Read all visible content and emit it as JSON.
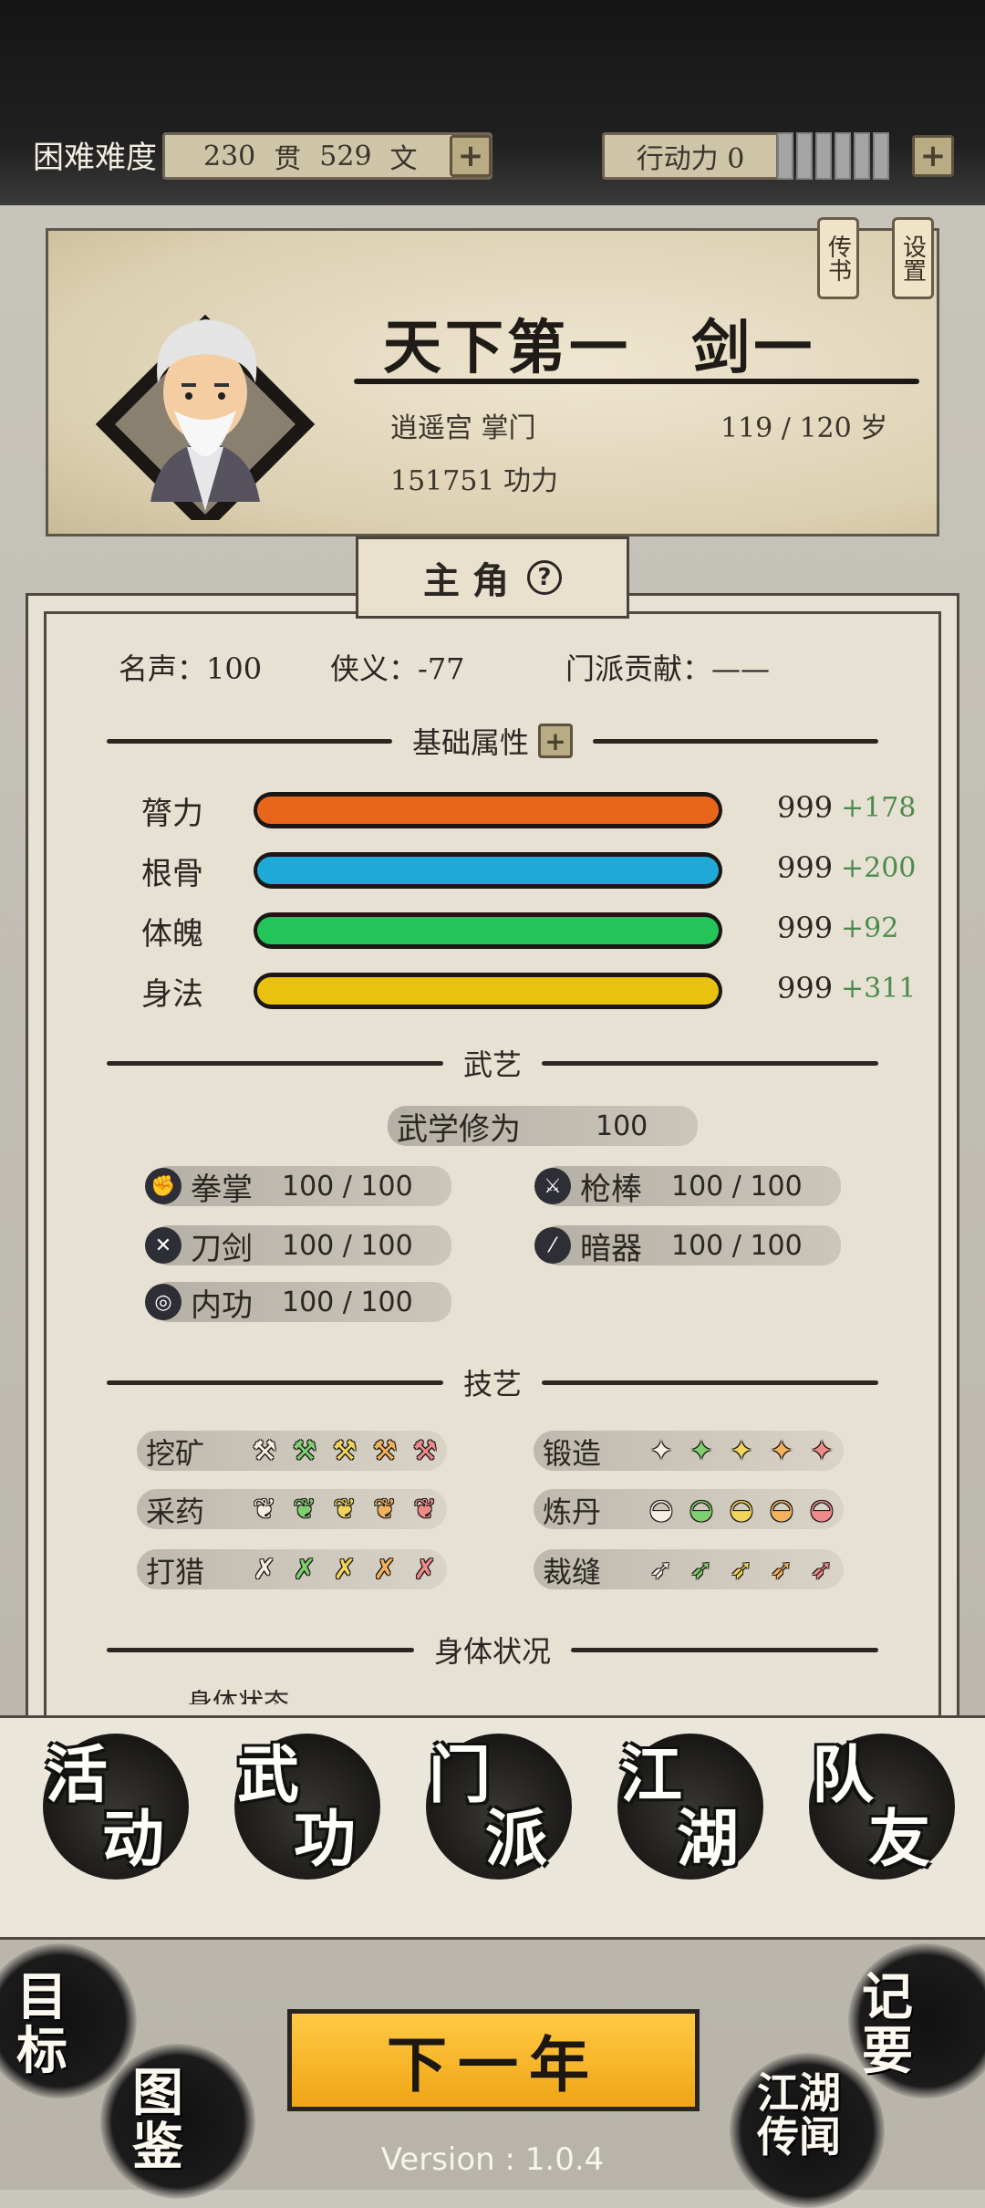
{
  "top_bar": {
    "difficulty": "困难难度",
    "money": {
      "guan_value": "230",
      "guan_unit": "贯",
      "wen_value": "529",
      "wen_unit": "文"
    },
    "action_points_label": "行动力 0",
    "action_points": {
      "value": 0,
      "max": 6
    }
  },
  "profile": {
    "title": "天下第一",
    "name": "剑一",
    "sect_role": "逍遥宫 掌门",
    "age": "119 / 120 岁",
    "power": "151751 功力",
    "tag_letters": "传书",
    "tag_settings": "设置"
  },
  "panel": {
    "tab_title": "主 角",
    "fame": "名声：100",
    "chivalry": "侠义：-77",
    "sect_contribution": "门派贡献：——"
  },
  "sections": {
    "basic": "基础属性",
    "martial": "武艺",
    "craft": "技艺",
    "body": "身体状况"
  },
  "attributes": [
    {
      "label": "膂力",
      "value": "999",
      "bonus": "+178",
      "fill": 1.0,
      "color": "#e8661a"
    },
    {
      "label": "根骨",
      "value": "999",
      "bonus": "+200",
      "fill": 1.0,
      "color": "#1fa9d6"
    },
    {
      "label": "体魄",
      "value": "999",
      "bonus": "+92",
      "fill": 1.0,
      "color": "#23c45a"
    },
    {
      "label": "身法",
      "value": "999",
      "bonus": "+311",
      "fill": 1.0,
      "color": "#e9c20f"
    }
  ],
  "martial": {
    "cultivation_label": "武学修为",
    "cultivation_value": "100",
    "skills": [
      {
        "label": "拳掌",
        "value": "100 / 100",
        "icon": "fist-icon"
      },
      {
        "label": "枪棒",
        "value": "100 / 100",
        "icon": "spear-icon"
      },
      {
        "label": "刀剑",
        "value": "100 / 100",
        "icon": "sword-icon"
      },
      {
        "label": "暗器",
        "value": "100 / 100",
        "icon": "dart-icon"
      },
      {
        "label": "内功",
        "value": "100 / 100",
        "icon": "inner-energy-icon"
      }
    ]
  },
  "crafts": [
    {
      "label": "挖矿",
      "icon": "pickaxe-icon",
      "level": 5
    },
    {
      "label": "锻造",
      "icon": "anvil-icon",
      "level": 5
    },
    {
      "label": "采药",
      "icon": "herb-icon",
      "level": 5
    },
    {
      "label": "炼丹",
      "icon": "bowl-icon",
      "level": 5
    },
    {
      "label": "打猎",
      "icon": "bow-icon",
      "level": 5
    },
    {
      "label": "裁缝",
      "icon": "needle-icon",
      "level": 5
    }
  ],
  "craft_tier_colors": [
    "#f3efe6",
    "#7fcf6f",
    "#f1d45a",
    "#f3b25d",
    "#ef8a8a"
  ],
  "body_status_partial": "身体状态",
  "nav": [
    "活动",
    "武功",
    "门派",
    "江湖",
    "队友"
  ],
  "corners": {
    "goals": "目标",
    "codex": "图鉴",
    "notes": "记要",
    "rumors": "江湖传闻"
  },
  "next_year": "下一年",
  "version": "Version : 1.0.4"
}
